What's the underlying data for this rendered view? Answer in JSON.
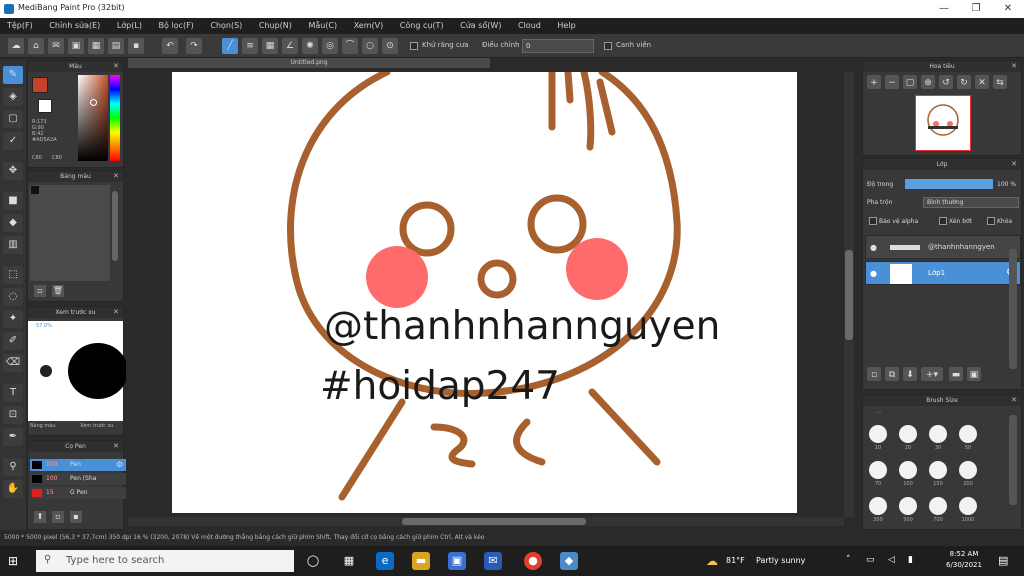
{
  "window": {
    "title": "MediBang Paint Pro (32bit)"
  },
  "menu": [
    "Tệp(F)",
    "Chỉnh sửa(E)",
    "Lớp(L)",
    "Bộ lọc(F)",
    "Chọn(S)",
    "Chụp(N)",
    "Mẫu(C)",
    "Xem(V)",
    "Công cụ(T)",
    "Cửa sổ(W)",
    "Cloud",
    "Help"
  ],
  "toolbar": {
    "anti_alias_label": "Khử răng cưa",
    "correction_label": "Điều chỉnh",
    "correction_value": "0",
    "snap_label": "Canh viền"
  },
  "document": {
    "tab_name": "Untitled.png"
  },
  "panels": {
    "color": {
      "title": "Màu",
      "rgb_lines": [
        "R:173",
        "G:90",
        "B:42",
        "#AD5A2A"
      ],
      "hex_values": [
        "C80",
        "C80"
      ]
    },
    "palette": {
      "title": "Bảng màu"
    },
    "navigator": {
      "title": "Xem trước xu",
      "zoom": "57.0%",
      "tab1": "Bảng màu",
      "tab2": "Xem trước xu"
    },
    "pen": {
      "title": "Cọ Pen",
      "rows": [
        {
          "size": "100",
          "name": "Pen"
        },
        {
          "size": "100",
          "name": "Pen (Sha"
        },
        {
          "size": "15",
          "name": "G Pen"
        }
      ]
    },
    "overview": {
      "title": "Hoa tiêu"
    },
    "layer": {
      "title": "Lớp",
      "opacity_label": "Độ trong",
      "opacity_value": "100 %",
      "blend_label": "Pha trộn",
      "blend_value": "Bình thường",
      "protect_label": "Bảo vệ alpha",
      "clip_label": "Xén bớt",
      "lock_label": "Khóa",
      "layers": [
        {
          "name": "@thanhnhanngyen",
          "type": "text"
        },
        {
          "name": "Lớp1",
          "type": "raster"
        }
      ]
    },
    "brush_size": {
      "title": "Brush Size",
      "sizes": [
        "10",
        "20",
        "30",
        "50",
        "70",
        "100",
        "150",
        "200",
        "300",
        "500",
        "700",
        "1000"
      ]
    }
  },
  "artwork": {
    "watermark_line1": "@thanhnhannguyen",
    "watermark_line2": "#hoidap247",
    "stroke_color": "#a8612e",
    "blush_color": "#ff6b6b"
  },
  "status": {
    "text": "5000 * 5000 pixel  (56,3 * 37,7cm)  350 dpi  16 %  (3200, 2078)  Vẽ một đường thẳng bằng cách giữ phím Shift, Thay đổi cỡ cọ bằng cách giữ phím Ctrl, Alt và kéo"
  },
  "taskbar": {
    "search_placeholder": "Type here to search",
    "weather_temp": "81°F",
    "weather_text": "Partly sunny",
    "time": "8:52 AM",
    "date": "6/30/2021"
  }
}
